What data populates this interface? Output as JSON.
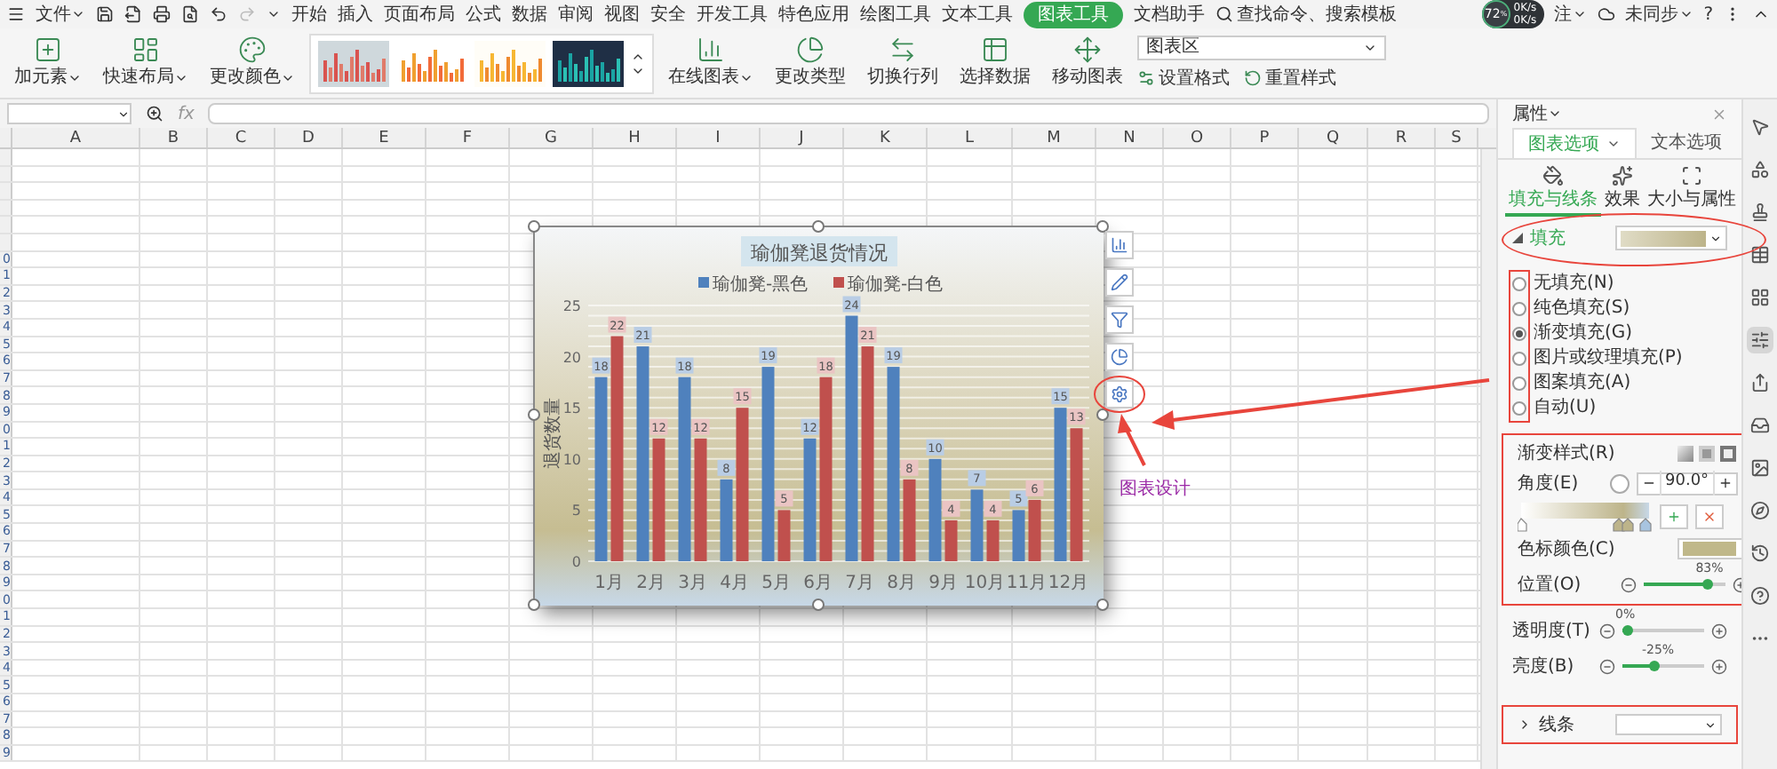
{
  "menu_bar": {
    "file": "文件",
    "tabs": [
      {
        "label": "开始",
        "selected": false
      },
      {
        "label": "插入",
        "selected": false
      },
      {
        "label": "页面布局",
        "selected": false
      },
      {
        "label": "公式",
        "selected": false
      },
      {
        "label": "数据",
        "selected": false
      },
      {
        "label": "审阅",
        "selected": false
      },
      {
        "label": "视图",
        "selected": false
      },
      {
        "label": "安全",
        "selected": false
      },
      {
        "label": "开发工具",
        "selected": false
      },
      {
        "label": "特色应用",
        "selected": false
      },
      {
        "label": "绘图工具",
        "selected": false
      },
      {
        "label": "文本工具",
        "selected": false
      },
      {
        "label": "图表工具",
        "selected": true
      },
      {
        "label": "文档助手",
        "selected": false
      }
    ],
    "search": "查找命令、搜索模板",
    "comment": "注",
    "sync": "未同步",
    "help": "?"
  },
  "monitor": {
    "value": "72",
    "unit": "%",
    "rates": [
      "0K/s",
      "0K/s"
    ]
  },
  "ribbon": {
    "left_buttons": [
      {
        "label": "加元素",
        "kind": "add",
        "dropdown": true
      },
      {
        "label": "快速布局",
        "kind": "layout",
        "dropdown": true
      },
      {
        "label": "更改颜色",
        "kind": "color",
        "dropdown": true
      }
    ],
    "styles": [
      {
        "kind": "gradient"
      },
      {
        "kind": "orange"
      },
      {
        "kind": "orange_grid"
      },
      {
        "kind": "dark"
      }
    ],
    "right_buttons": [
      {
        "label": "在线图表",
        "kind": "online",
        "dropdown": true
      },
      {
        "label": "更改类型",
        "kind": "type",
        "dropdown": false
      },
      {
        "label": "切换行列",
        "kind": "switch",
        "dropdown": false
      },
      {
        "label": "选择数据",
        "kind": "data",
        "dropdown": false
      },
      {
        "label": "移动图表",
        "kind": "move",
        "dropdown": false
      }
    ],
    "element_select": "图表区",
    "format": "设置格式",
    "reset": "重置样式"
  },
  "formula_bar": {
    "fx": "fx"
  },
  "columns": [
    "A",
    "B",
    "C",
    "D",
    "E",
    "F",
    "G",
    "H",
    "I",
    "J",
    "K",
    "L",
    "M",
    "N",
    "O",
    "P",
    "Q",
    "R",
    "S"
  ],
  "row_numbers": [
    "0",
    "1",
    "2",
    "3",
    "4",
    "5",
    "6",
    "7",
    "8",
    "9",
    "0",
    "1",
    "2",
    "3",
    "4",
    "5",
    "6",
    "7",
    "8",
    "9",
    "0",
    "1",
    "2",
    "3",
    "4",
    "5",
    "6",
    "7",
    "8",
    "9"
  ],
  "chart": {
    "chart_data": {
      "type": "bar",
      "title": "瑜伽凳退货情况",
      "ylabel": "退货数量",
      "categories": [
        "1月",
        "2月",
        "3月",
        "4月",
        "5月",
        "6月",
        "7月",
        "8月",
        "9月",
        "10月",
        "11月",
        "12月"
      ],
      "series": [
        {
          "name": "瑜伽凳-黑色",
          "color": "#4f81bd",
          "values": [
            18,
            21,
            18,
            8,
            19,
            12,
            24,
            19,
            10,
            7,
            5,
            15
          ]
        },
        {
          "name": "瑜伽凳-白色",
          "color": "#c0504d",
          "values": [
            22,
            12,
            12,
            15,
            5,
            18,
            21,
            8,
            4,
            4,
            6,
            13
          ]
        }
      ],
      "ylim": [
        0,
        25
      ],
      "yticks": [
        0,
        5,
        10,
        15,
        20,
        25
      ],
      "data_labels": true,
      "grid": true,
      "legend": true
    }
  },
  "chart_tools": [
    {
      "kind": "elements"
    },
    {
      "kind": "style"
    },
    {
      "kind": "filter"
    },
    {
      "kind": "analysis"
    },
    {
      "kind": "settings"
    }
  ],
  "annotation": {
    "label": "图表设计"
  },
  "panel": {
    "title": "属性",
    "tabs": [
      {
        "label": "图表选项",
        "selected": true
      },
      {
        "label": "文本选项",
        "selected": false
      }
    ],
    "subtabs": [
      {
        "label": "填充与线条",
        "kind": "fill",
        "selected": true
      },
      {
        "label": "效果",
        "kind": "effect",
        "selected": false
      },
      {
        "label": "大小与属性",
        "kind": "size",
        "selected": false
      }
    ],
    "fill": {
      "label": "填充",
      "expanded": true
    },
    "fill_options": [
      {
        "label": "无填充(N)",
        "selected": false
      },
      {
        "label": "纯色填充(S)",
        "selected": false
      },
      {
        "label": "渐变填充(G)",
        "selected": true
      },
      {
        "label": "图片或纹理填充(P)",
        "selected": false
      },
      {
        "label": "图案填充(A)",
        "selected": false
      },
      {
        "label": "自动(U)",
        "selected": false
      }
    ],
    "gradient_style": "渐变样式(R)",
    "angle": {
      "label": "角度(E)",
      "value": "90.0°"
    },
    "stop_color": "色标颜色(C)",
    "sliders": [
      {
        "label": "位置(O)",
        "level": 0.83,
        "reading": "83%"
      },
      {
        "label": "透明度(T)",
        "level": 0,
        "reading": "0%"
      },
      {
        "label": "亮度(B)",
        "level": 0.375,
        "reading": "-25%"
      }
    ],
    "line": {
      "label": "线条",
      "expanded": false
    }
  },
  "side_strip": [
    {
      "kind": "pointer",
      "selected": false
    },
    {
      "kind": "shapes",
      "selected": false
    },
    {
      "kind": "stamp",
      "selected": false
    },
    {
      "kind": "table",
      "selected": false
    },
    {
      "kind": "grid",
      "selected": false
    },
    {
      "kind": "properties",
      "selected": true
    },
    {
      "kind": "share",
      "selected": false
    },
    {
      "kind": "inbox",
      "selected": false
    },
    {
      "kind": "image",
      "selected": false
    },
    {
      "kind": "compass",
      "selected": false
    },
    {
      "kind": "history",
      "selected": false
    },
    {
      "kind": "help",
      "selected": false
    },
    {
      "kind": "more",
      "selected": false
    }
  ]
}
